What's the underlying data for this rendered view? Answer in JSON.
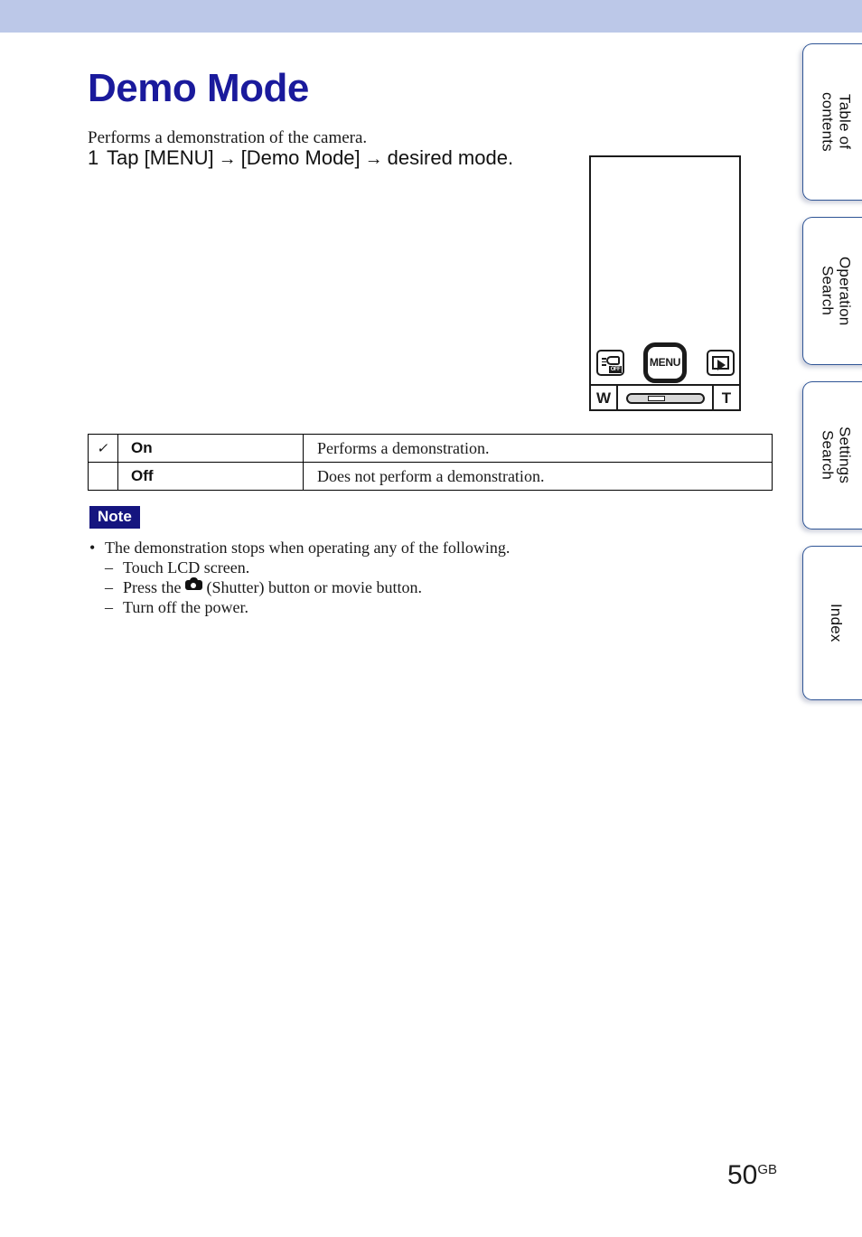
{
  "header": {
    "band_color": "#bcc8e8"
  },
  "page": {
    "title": "Demo Mode",
    "title_color": "#1a1a9c",
    "intro": "Performs a demonstration of the camera.",
    "page_number": "50",
    "page_number_suffix": "GB"
  },
  "step": {
    "number": "1",
    "part1": "Tap [MENU]",
    "arrow1": "→",
    "part2": "[Demo Mode]",
    "arrow2": "→",
    "part3": "desired mode."
  },
  "camera_figure": {
    "flash_off_label": "OFF",
    "menu_button_label": "MENU",
    "playback_label": "play-triangle",
    "zoom_wide_label": "W",
    "zoom_tele_label": "T"
  },
  "settings_table": {
    "rows": [
      {
        "selected_mark": "✓",
        "option": "On",
        "description": "Performs a demonstration."
      },
      {
        "selected_mark": "",
        "option": "Off",
        "description": "Does not perform a demonstration."
      }
    ]
  },
  "note": {
    "badge": "Note",
    "badge_bg": "#15157f",
    "bullet": "•",
    "dash": "–",
    "items": [
      "The demonstration stops when operating any of the following."
    ],
    "sub_items_pre": [
      "Touch LCD screen.",
      "Press the ",
      "Turn off the power."
    ],
    "shutter_suffix": "(Shutter) button or movie button."
  },
  "side_tabs": [
    {
      "label": "Table of\ncontents"
    },
    {
      "label": "Operation\nSearch"
    },
    {
      "label": "Settings\nSearch"
    },
    {
      "label": "Index"
    }
  ]
}
